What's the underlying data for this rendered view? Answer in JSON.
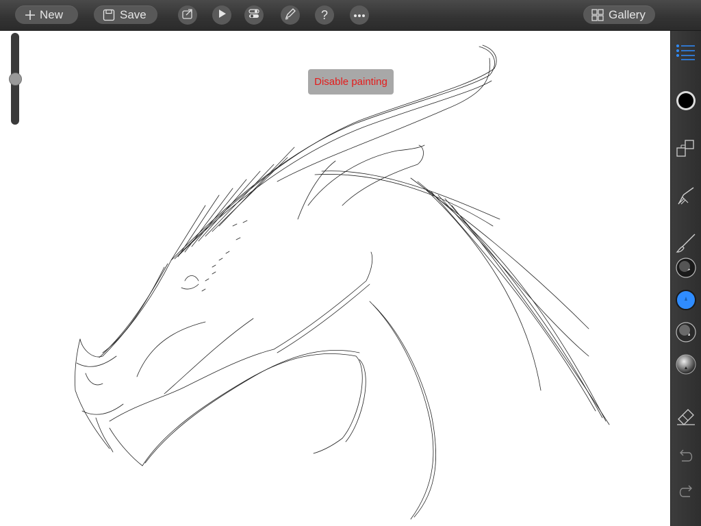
{
  "toolbar": {
    "new_label": "New",
    "save_label": "Save",
    "gallery_label": "Gallery",
    "icons": [
      "plus-icon",
      "save-icon",
      "share-icon",
      "play-icon",
      "toggle-icon",
      "pen-icon",
      "help-icon",
      "more-icon",
      "gallery-grid-icon"
    ]
  },
  "canvas": {
    "disable_painting_label": "Disable painting",
    "size_slider_value": 0.5
  },
  "sidebar": {
    "icons": [
      "layers-list-icon",
      "color-swatch-icon",
      "duplicate-layer-icon",
      "smudge-tool-icon",
      "paint-brush-icon",
      "brush-preset-1-icon",
      "brush-preset-2-icon",
      "brush-preset-3-icon",
      "brush-preset-4-icon",
      "eraser-icon",
      "undo-icon",
      "redo-icon"
    ],
    "selected_color": "#000000",
    "accent_color": "#2f8cff"
  },
  "colors": {
    "toolbar_bg": "#333333",
    "button_bg": "#585858",
    "disable_text": "#e41b1b"
  }
}
